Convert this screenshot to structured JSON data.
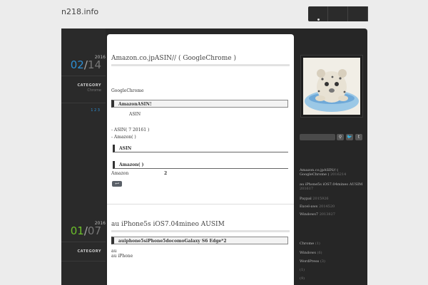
{
  "site": {
    "title": "n218.info"
  },
  "posts": [
    {
      "year": "2016",
      "month": "02",
      "day": "14",
      "category_label": "CATEGORY",
      "category_value": "Chrome",
      "pages": "1 2 3",
      "title": "Amazon.co.jpASIN// ( GoogleChrome )",
      "intro": "GoogleChrome",
      "heading1": "AmazonASIN!",
      "asin_label": "ASIN",
      "list1": "- ASIN( 7 20161 )",
      "list2": "- Amazon(  )",
      "heading2": "ASIN",
      "heading3": "Amazon(  )",
      "amazon_text": "Amazon",
      "amazon_num": "2",
      "back_icon": "back-arrow-icon"
    },
    {
      "year": "2016",
      "month": "01",
      "day": "07",
      "category_label": "CATEGORY",
      "title": "au iPhone5s iOS7.04mineo AUSIM",
      "heading1": "auiphone5siPhone5docomoGalaxy S6 Edge*2",
      "line1": "au",
      "line2": "au iPhone"
    }
  ],
  "sidebar": {
    "photo_alt": "snow leopard cub in a blue bucket",
    "search_icon": "search-icon",
    "twitter_icon": "twitter-icon",
    "recent": [
      {
        "title": "Amazon.co.jpASIN// (",
        "title2": "GoogleChrome )",
        "date": "2016214"
      },
      {
        "title": "au iPhone5s iOS7.04mineo AUSIM",
        "date": "201617"
      },
      {
        "title": "Paypal",
        "date": "2015926"
      },
      {
        "title": "Excel-aws",
        "date": "2014520"
      },
      {
        "title": "Windows7",
        "date": "2013827"
      }
    ],
    "categories": [
      {
        "name": "Chrome",
        "count": "(1)"
      },
      {
        "name": "Windows",
        "count": "(6)"
      },
      {
        "name": "WordPress",
        "count": "(3)"
      },
      {
        "name": "",
        "count": "(1)"
      },
      {
        "name": "",
        "count": "(9)"
      }
    ]
  }
}
